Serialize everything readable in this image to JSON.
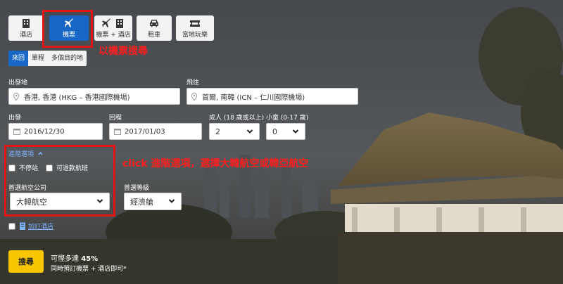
{
  "product_tabs": [
    {
      "label": "酒店",
      "icon": "hotel-icon"
    },
    {
      "label": "機票",
      "icon": "plane-icon",
      "active": true
    },
    {
      "label": "機票 + 酒店",
      "icon": "plane-hotel-icon"
    },
    {
      "label": "租車",
      "icon": "car-icon"
    },
    {
      "label": "當地玩樂",
      "icon": "ticket-icon"
    }
  ],
  "annotations": {
    "tab_note": "以機票搜尋",
    "advanced_note": "click 進階選項，選擇大韓航空或韓亞航空"
  },
  "trip_types": [
    {
      "label": "來回",
      "active": true
    },
    {
      "label": "單程"
    },
    {
      "label": "多個目的地"
    }
  ],
  "origin": {
    "label": "出發地",
    "value": "香港, 香港 (HKG – 香港國際機場)",
    "icon": "location-pin-icon"
  },
  "destination": {
    "label": "飛往",
    "value": "首爾, 南韓 (ICN – 仁川國際機場)",
    "icon": "location-pin-icon"
  },
  "depart": {
    "label": "出發",
    "value": "2016/12/30",
    "icon": "calendar-icon"
  },
  "return": {
    "label": "回程",
    "value": "2017/01/03",
    "icon": "calendar-icon"
  },
  "adults": {
    "label": "成人 (18 歲或以上)",
    "value": "2"
  },
  "children": {
    "label": "小童 (0-17 歲)",
    "value": "0"
  },
  "advanced": {
    "toggle_label": "進階選項",
    "nonstop_label": "不停站",
    "refundable_label": "可退款航班",
    "airline_label": "首選航空公司",
    "airline_value": "大韓航空",
    "class_label": "首選等級",
    "class_value": "經濟艙"
  },
  "add_hotel_label": "加訂酒店",
  "search_label": "搜尋",
  "promo": {
    "line1_prefix": "可慳多達",
    "line1_amount": "45%",
    "line2": "同時預訂機票 + 酒店即可*"
  },
  "colors": {
    "accent": "#1768c6",
    "annotation": "#e01515",
    "search_button": "#f7c600"
  }
}
